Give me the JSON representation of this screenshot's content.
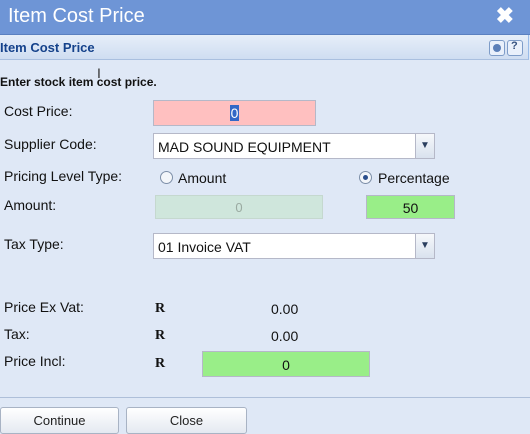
{
  "window": {
    "title": "Item Cost Price",
    "close_glyph": "✖"
  },
  "panel": {
    "title": "Item Cost Price",
    "tools": [
      "gear-icon",
      "help-icon"
    ]
  },
  "instruction": "Enter stock item cost price.",
  "form": {
    "cost_price": {
      "label": "Cost Price:",
      "value": "0"
    },
    "supplier_code": {
      "label": "Supplier Code:",
      "value": "MAD SOUND EQUIPMENT"
    },
    "pricing_level_type": {
      "label": "Pricing Level Type:",
      "options": [
        "Amount",
        "Percentage"
      ],
      "selected": "Percentage"
    },
    "amount": {
      "label": "Amount:",
      "amount_value": "0",
      "percentage_value": "50"
    },
    "tax_type": {
      "label": "Tax Type:",
      "value": "01 Invoice VAT"
    }
  },
  "summary": {
    "currency_symbol": "R",
    "price_ex_vat": {
      "label": "Price Ex Vat:",
      "value": "0.00"
    },
    "tax": {
      "label": "Tax:",
      "value": "0.00"
    },
    "price_incl": {
      "label": "Price Incl:",
      "value": "0"
    }
  },
  "buttons": {
    "continue": "Continue",
    "close": "Close"
  },
  "colors": {
    "title_bar": "#6e95d6",
    "required_field": "#ffc0c0",
    "active_field": "#99ee88",
    "disabled_field": "#cfe6dc",
    "panel_title": "#15428b"
  }
}
